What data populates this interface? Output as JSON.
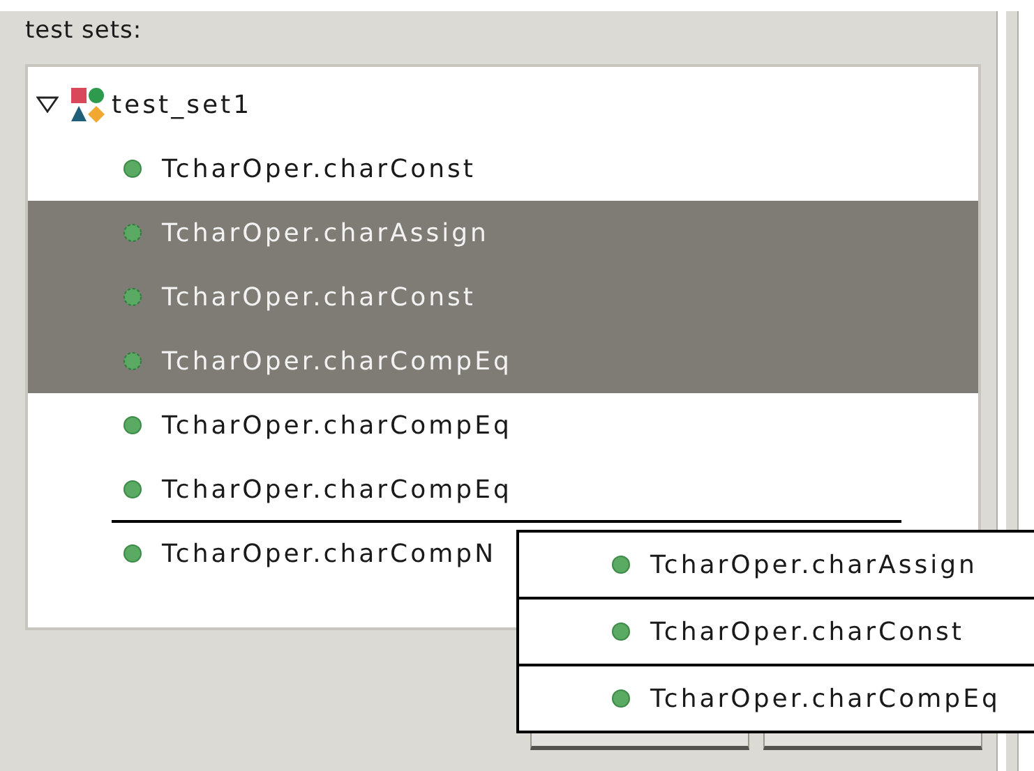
{
  "label": "test sets:",
  "tree": {
    "label": "test_set1",
    "expanded": true,
    "children": [
      {
        "label": "TcharOper.charConst",
        "selected": false
      },
      {
        "label": "TcharOper.charAssign",
        "selected": true
      },
      {
        "label": "TcharOper.charConst",
        "selected": true
      },
      {
        "label": "TcharOper.charCompEq",
        "selected": true
      },
      {
        "label": "TcharOper.charCompEq",
        "selected": false
      },
      {
        "label": "TcharOper.charCompEq",
        "selected": false,
        "drop_target": true
      },
      {
        "label": "TcharOper.charCompN",
        "selected": false
      }
    ]
  },
  "dragged_items": [
    {
      "label": "TcharOper.charAssign"
    },
    {
      "label": "TcharOper.charConst"
    },
    {
      "label": "TcharOper.charCompEq"
    }
  ]
}
